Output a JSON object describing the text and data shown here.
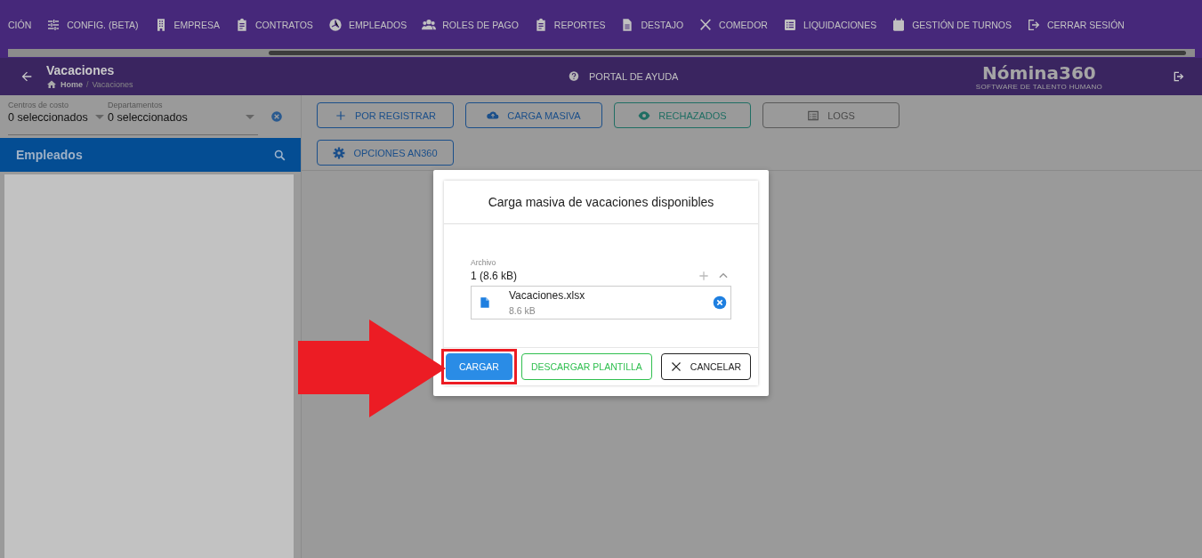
{
  "nav_menu": [
    {
      "label": "CIÓN"
    },
    {
      "label": "CONFIG. (BETA)"
    },
    {
      "label": "EMPRESA"
    },
    {
      "label": "CONTRATOS"
    },
    {
      "label": "EMPLEADOS"
    },
    {
      "label": "ROLES DE PAGO"
    },
    {
      "label": "REPORTES"
    },
    {
      "label": "DESTAJO"
    },
    {
      "label": "COMEDOR"
    },
    {
      "label": "LIQUIDACIONES"
    },
    {
      "label": "GESTIÓN DE TURNOS"
    },
    {
      "label": "CERRAR SESIÓN"
    }
  ],
  "header": {
    "title": "Vacaciones",
    "breadcrumb": [
      "Home",
      "Vacaciones"
    ],
    "breadcrumb_separator": "/",
    "help_link": "PORTAL DE AYUDA",
    "logo": "Nómina360",
    "logo_tagline": "SOFTWARE DE TALENTO HUMANO"
  },
  "filters": [
    {
      "label": "Centros de costo",
      "value": "0 seleccionados"
    },
    {
      "label": "Departamentos",
      "value": "0 seleccionados"
    }
  ],
  "sidebar": {
    "title": "Empleados"
  },
  "actions": [
    {
      "label": "POR REGISTRAR",
      "kind": "blue"
    },
    {
      "label": "CARGA MASIVA",
      "kind": "blue"
    },
    {
      "label": "RECHAZADOS",
      "kind": "teal"
    },
    {
      "label": "LOGS",
      "kind": "gray"
    },
    {
      "label": "OPCIONES AN360",
      "kind": "blue"
    }
  ],
  "dialog": {
    "title": "Carga masiva de vacaciones disponibles",
    "field_label": "Archivo",
    "summary": "1 (8.6 kB)",
    "files": [
      {
        "name": "Vacaciones.xlsx",
        "size": "8.6 kB"
      }
    ],
    "buttons": [
      {
        "label": "CARGAR",
        "kind": "primary",
        "highlighted": true
      },
      {
        "label": "DESCARGAR PLANTILLA",
        "kind": "success",
        "highlighted": false
      },
      {
        "label": "CANCELAR",
        "kind": "cancel",
        "highlighted": false
      }
    ]
  }
}
